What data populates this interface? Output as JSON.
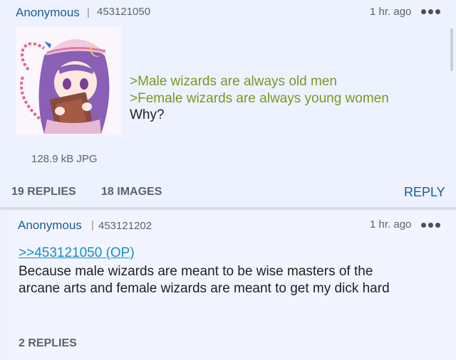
{
  "op": {
    "name": "Anonymous",
    "separator": "|",
    "post_number": "453121050",
    "time": "1 hr. ago",
    "menu_icon": "more-dots-icon",
    "greentext": [
      ">Male wizards are always old men",
      ">Female wizards are always young women"
    ],
    "text": "Why?",
    "file_info": "128.9 kB JPG",
    "replies": "19 REPLIES",
    "images": "18 IMAGES",
    "reply_button": "REPLY"
  },
  "reply": {
    "name": "Anonymous",
    "separator": "|",
    "post_number": "453121202",
    "time": "1 hr. ago",
    "menu_icon": "more-dots-icon",
    "quote_link": ">>453121050 (OP)",
    "text_lines": [
      "Because male wizards are meant to be wise masters of the",
      "arcane arts and female wizards are meant to get my dick hard"
    ],
    "replies": "2 REPLIES"
  },
  "colors": {
    "name": "#1a5c9a",
    "greentext": "#789922",
    "quote_link": "#1a8cc4",
    "background": "#eef2fe"
  }
}
